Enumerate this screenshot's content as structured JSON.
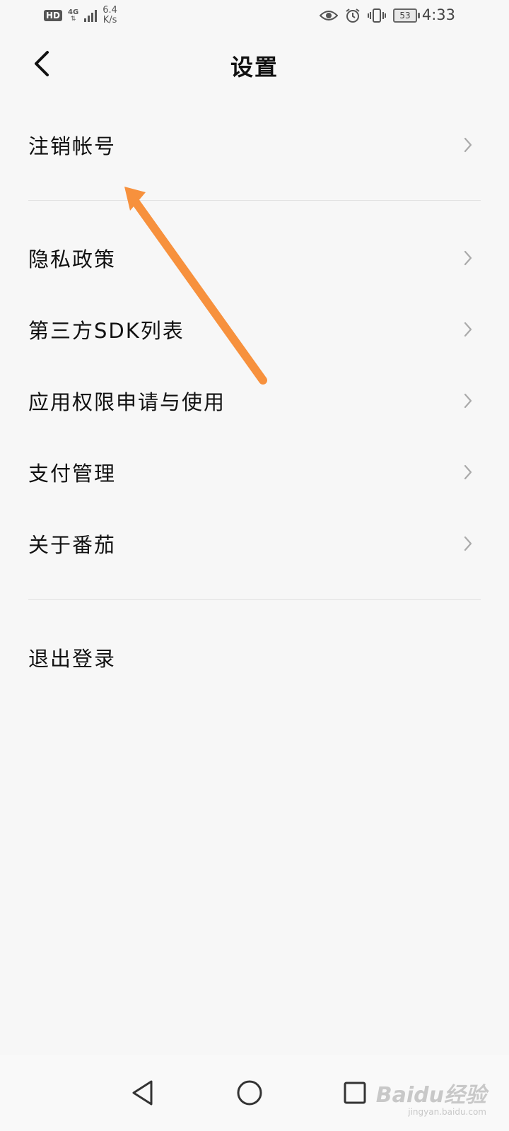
{
  "status_bar": {
    "hd": "HD",
    "network_type": "4G",
    "net_speed_value": "6.4",
    "net_speed_unit": "K/s",
    "battery": "53",
    "time": "4:33"
  },
  "header": {
    "title": "设置"
  },
  "groups": [
    {
      "items": [
        {
          "label": "注销帐号"
        }
      ]
    },
    {
      "items": [
        {
          "label": "隐私政策"
        },
        {
          "label": "第三方SDK列表"
        },
        {
          "label": "应用权限申请与使用"
        },
        {
          "label": "支付管理"
        },
        {
          "label": "关于番茄"
        }
      ]
    },
    {
      "items": [
        {
          "label": "退出登录"
        }
      ]
    }
  ],
  "annotation": {
    "color": "#f7913d"
  },
  "watermark": {
    "brand": "Baidu经验",
    "url": "jingyan.baidu.com"
  },
  "icons": {
    "back": "chevron-left-icon",
    "item_arrow": "chevron-right-icon",
    "nav_back": "triangle-back-icon",
    "nav_home": "circle-home-icon",
    "nav_recent": "square-recent-icon"
  }
}
